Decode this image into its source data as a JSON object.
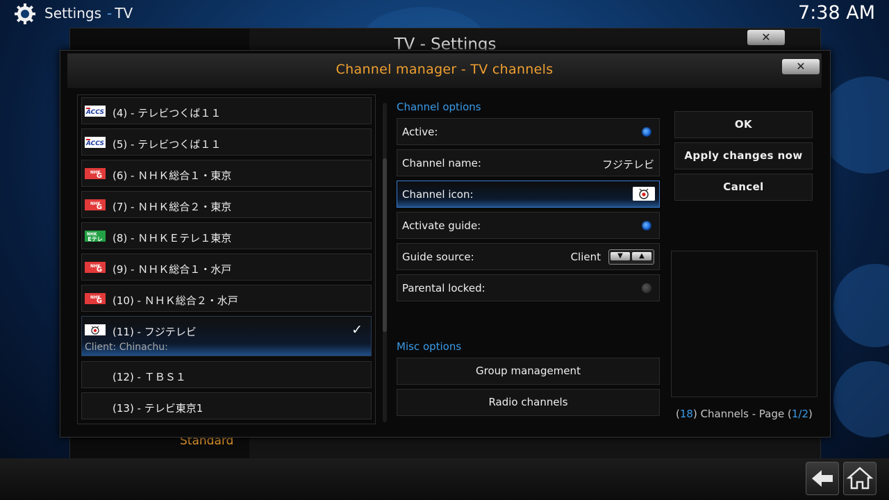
{
  "topbar": {
    "section": "Settings",
    "separator": "-",
    "subsection": "TV",
    "clock": "7:38 AM"
  },
  "background_window": {
    "title": "TV - Settings",
    "close_label": "✕",
    "menu_item": "Standard"
  },
  "dialog": {
    "title": "Channel manager - TV channels",
    "close_label": "✕"
  },
  "channels": [
    {
      "label": "(4) - テレビつくば１１",
      "logo": "accs"
    },
    {
      "label": "(5) - テレビつくば１１",
      "logo": "accs"
    },
    {
      "label": "(6) - ＮＨＫ総合１・東京",
      "logo": "nhk-g"
    },
    {
      "label": "(7) - ＮＨＫ総合２・東京",
      "logo": "nhk-g"
    },
    {
      "label": "(8) - ＮＨＫＥテレ１東京",
      "logo": "nhk-etele"
    },
    {
      "label": "(9) - ＮＨＫ総合１・水戸",
      "logo": "nhk-g"
    },
    {
      "label": "(10) - ＮＨＫ総合２・水戸",
      "logo": "nhk-g"
    },
    {
      "label": "(11) - フジテレビ",
      "logo": "fuji",
      "sub": "Client: Chinachu:",
      "check": "✓"
    },
    {
      "label": "(12) - ＴＢＳ１",
      "logo": ""
    },
    {
      "label": "(13) - テレビ東京1",
      "logo": ""
    }
  ],
  "channel_options": {
    "title": "Channel options",
    "active_label": "Active:",
    "name_label": "Channel name:",
    "name_value": "フジテレビ",
    "icon_label": "Channel icon:",
    "guide_label": "Activate guide:",
    "source_label": "Guide source:",
    "source_value": "Client",
    "source_down": "▼",
    "source_up": "▲",
    "parental_label": "Parental locked:"
  },
  "misc_options": {
    "title": "Misc options",
    "group_button": "Group management",
    "radio_button": "Radio channels"
  },
  "buttons": {
    "ok": "OK",
    "apply": "Apply changes now",
    "cancel": "Cancel"
  },
  "footer": {
    "open": "(",
    "count": "18",
    "mid": ") Channels - Page (",
    "page": "1/2",
    "close": ")"
  },
  "colors": {
    "accent": "#3a9be8",
    "title_orange": "#f0a030",
    "radio_on": "#1a6ae0"
  }
}
